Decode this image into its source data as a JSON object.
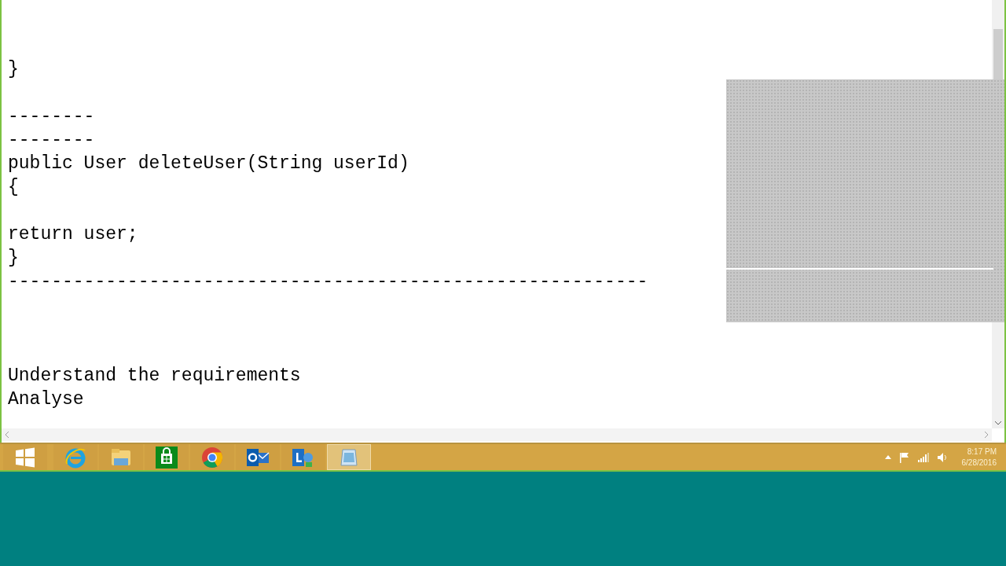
{
  "editor": {
    "lines": [
      {
        "kind": "text",
        "text": "}"
      },
      {
        "kind": "blank"
      },
      {
        "kind": "text",
        "text": "--------"
      },
      {
        "kind": "text",
        "text": "--------"
      },
      {
        "kind": "text",
        "text": "public User deleteUser(String userId)"
      },
      {
        "kind": "text",
        "text": "{"
      },
      {
        "kind": "blank"
      },
      {
        "kind": "text",
        "text": "return user;"
      },
      {
        "kind": "text",
        "text": "}"
      },
      {
        "kind": "text",
        "text": "-----------------------------------------------------------"
      },
      {
        "kind": "blank"
      },
      {
        "kind": "blank"
      },
      {
        "kind": "blank"
      },
      {
        "kind": "text",
        "text": "Understand the requirements"
      },
      {
        "kind": "text",
        "text": "Analyse"
      }
    ]
  },
  "taskbar": {
    "apps": [
      {
        "kind": "start",
        "selected": false
      },
      {
        "kind": "ie",
        "selected": false
      },
      {
        "kind": "explorer",
        "selected": false
      },
      {
        "kind": "store",
        "selected": false
      },
      {
        "kind": "chrome",
        "selected": false
      },
      {
        "kind": "outlook",
        "selected": false
      },
      {
        "kind": "lync",
        "selected": false
      },
      {
        "kind": "notepad",
        "selected": true
      }
    ],
    "tray": {
      "time": "8:17 PM",
      "date": "6/28/2016"
    }
  }
}
